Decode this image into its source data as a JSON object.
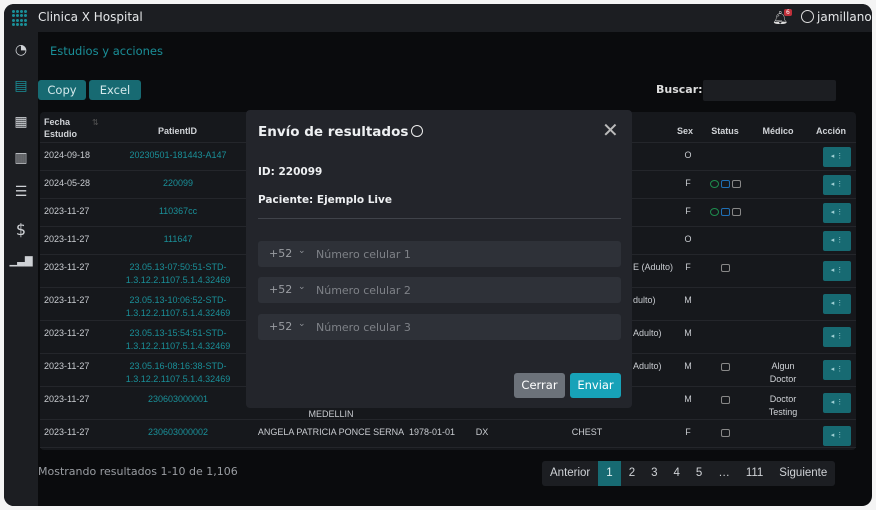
{
  "app": {
    "title": "Clinica X Hospital",
    "notifications": "6",
    "username": "jamillano"
  },
  "sidebar": {
    "items": [
      {
        "icon": "dashboard-icon"
      },
      {
        "icon": "document-icon",
        "active": true
      },
      {
        "icon": "calendar-icon"
      },
      {
        "icon": "hospital-icon"
      },
      {
        "icon": "list-icon"
      },
      {
        "icon": "dollar-icon"
      },
      {
        "icon": "bar-chart-icon"
      }
    ]
  },
  "page": {
    "title": "Estudios y acciones",
    "copy": "Copy",
    "excel": "Excel",
    "search_label": "Buscar:",
    "search_value": ""
  },
  "table": {
    "headers": {
      "fecha": "Fecha Estudio",
      "patient_id": "PatientID",
      "sex": "Sex",
      "status": "Status",
      "medico": "Médico",
      "accion": "Acción"
    },
    "rows": [
      {
        "fecha": "2024-09-18",
        "pid": "20230501-181443-A147",
        "name": "",
        "birth": "",
        "mod": "",
        "study": "",
        "sex": "O",
        "status": [],
        "medico": ""
      },
      {
        "fecha": "2024-05-28",
        "pid": "220099",
        "name": "",
        "birth": "",
        "mod": "",
        "study": "",
        "sex": "F",
        "status": [
          "whatsapp",
          "email",
          "document"
        ],
        "medico": ""
      },
      {
        "fecha": "2023-11-27",
        "pid": "110367cc",
        "name": "",
        "birth": "",
        "mod": "",
        "study": "",
        "sex": "F",
        "status": [
          "whatsapp",
          "email",
          "document"
        ],
        "medico": ""
      },
      {
        "fecha": "2023-11-27",
        "pid": "111647",
        "name": "",
        "birth": "",
        "mod": "",
        "study": "",
        "sex": "O",
        "status": [],
        "medico": ""
      },
      {
        "fecha": "2023-11-27",
        "pid": "23.05.13-07:50:51-STD-1.3.12.2.1107.5.1.4.32469",
        "name": "",
        "birth": "",
        "mod": "",
        "study": "E (Adulto)",
        "sex": "F",
        "status": [
          "document"
        ],
        "medico": ""
      },
      {
        "fecha": "2023-11-27",
        "pid": "23.05.13-10:06:52-STD-1.3.12.2.1107.5.1.4.32469",
        "name": "",
        "birth": "",
        "mod": "",
        "study": "dulto)",
        "sex": "M",
        "status": [],
        "medico": ""
      },
      {
        "fecha": "2023-11-27",
        "pid": "23.05.13-15:54:51-STD-1.3.12.2.1107.5.1.4.32469",
        "name": "",
        "birth": "",
        "mod": "",
        "study": "Adulto)",
        "sex": "M",
        "status": [],
        "medico": ""
      },
      {
        "fecha": "2023-11-27",
        "pid": "23.05.16-08:16:38-STD-1.3.12.2.1107.5.1.4.32469",
        "name": "",
        "birth": "",
        "mod": "",
        "study": "Adulto)",
        "sex": "M",
        "status": [
          "document"
        ],
        "medico": "Algun Doctor"
      },
      {
        "fecha": "2023-11-27",
        "pid": "230603000001",
        "name": "MEDELLIN",
        "birth": "",
        "mod": "",
        "study": "",
        "sex": "M",
        "status": [
          "document"
        ],
        "medico": "Doctor Testing"
      },
      {
        "fecha": "2023-11-27",
        "pid": "230603000002",
        "name": "ANGELA PATRICIA PONCE SERNA",
        "birth": "1978-01-01",
        "mod": "DX",
        "study": "CHEST",
        "sex": "F",
        "status": [
          "document"
        ],
        "medico": ""
      }
    ]
  },
  "footer": {
    "info": "Mostrando resultados 1-10 de 1,106",
    "pager": [
      "Anterior",
      "1",
      "2",
      "3",
      "4",
      "5",
      "…",
      "111",
      "Siguiente"
    ],
    "current": "1"
  },
  "modal": {
    "title": "Envío de resultados",
    "id_line": "ID: 220099",
    "patient_line": "Paciente: Ejemplo Live",
    "phones": [
      {
        "code": "+52",
        "placeholder": "Número celular 1",
        "value": ""
      },
      {
        "code": "+52",
        "placeholder": "Número celular 2",
        "value": ""
      },
      {
        "code": "+52",
        "placeholder": "Número celular 3",
        "value": ""
      }
    ],
    "cancel": "Cerrar",
    "send": "Enviar"
  },
  "colors": {
    "accent": "#1a8f98",
    "button": "#176a72",
    "send": "#17a2b8",
    "whatsapp": "#1e8c4e",
    "email": "#1f6fb5"
  }
}
